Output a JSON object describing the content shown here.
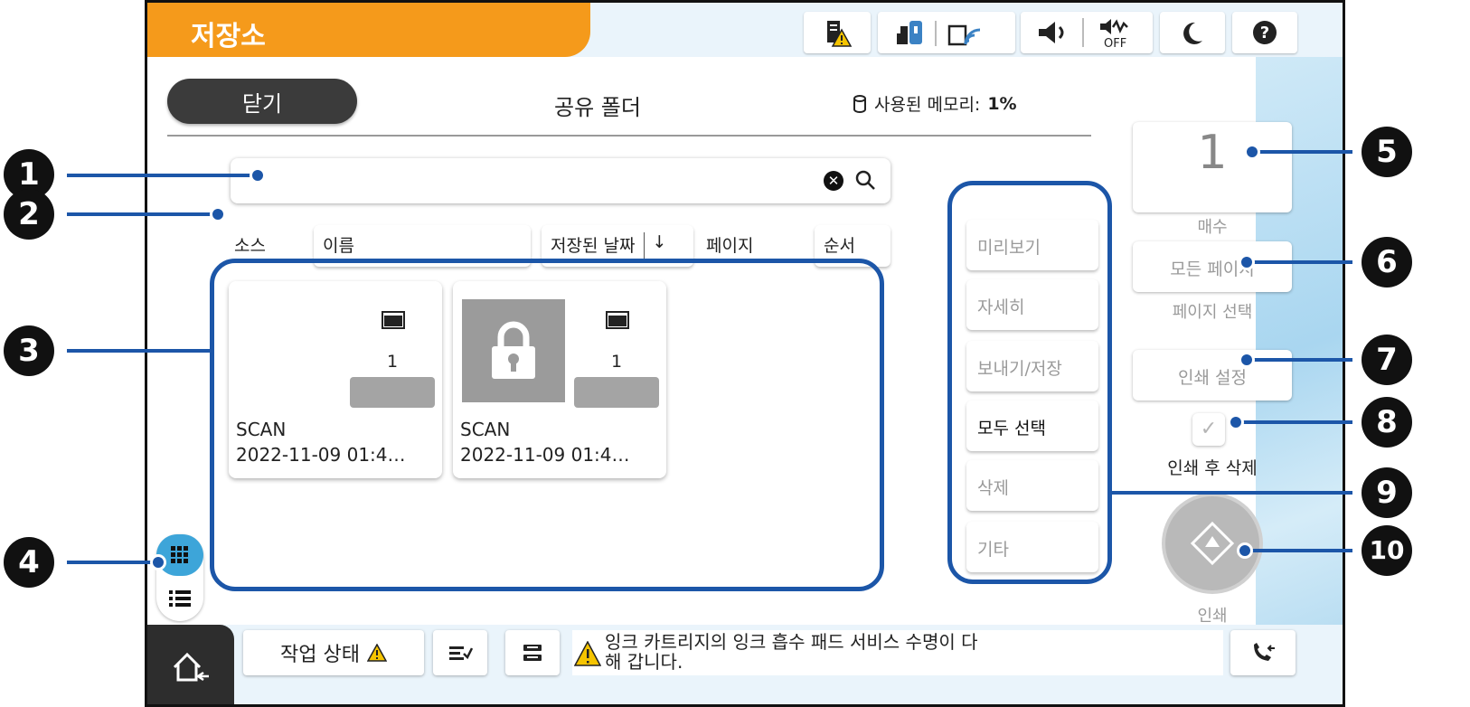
{
  "header": {
    "title": "저장소"
  },
  "main": {
    "close_label": "닫기",
    "page_title": "공유 폴더",
    "memory_label": "사용된 메모리:",
    "memory_value": "1%"
  },
  "sort_headers": {
    "source": "소스",
    "name": "이름",
    "date": "저장된 날짜",
    "date_sort_icon": "↓",
    "pages": "페이지",
    "order": "순서"
  },
  "files": [
    {
      "name": "SCAN",
      "date": "2022-11-09 01:4…",
      "pages": "1",
      "locked": false
    },
    {
      "name": "SCAN",
      "date": "2022-11-09 01:4…",
      "pages": "1",
      "locked": true
    }
  ],
  "menu": {
    "preview": "미리보기",
    "details": "자세히",
    "send_save": "보내기/저장",
    "select_all": "모두 선택",
    "delete": "삭제",
    "other": "기타"
  },
  "right_panel": {
    "copies_value": "1",
    "copies_label": "매수",
    "pages_value": "모든 페이지",
    "pages_label": "페이지 선택",
    "print_settings": "인쇄 설정",
    "delete_after_print": "인쇄 후 삭제",
    "delete_after_print_checked": false,
    "print_label": "인쇄"
  },
  "bottom": {
    "job_status": "작업 상태",
    "status_line1": "잉크 카트리지의 잉크 흡수 패드 서비스 수명이 다",
    "status_line2": "해 갑니다."
  },
  "callouts": [
    "1",
    "2",
    "3",
    "4",
    "5",
    "6",
    "7",
    "8",
    "9",
    "10"
  ],
  "icons": {
    "top": [
      "printer-warning-icon",
      "ink-icon",
      "wifi-icon",
      "volume-icon",
      "quiet-off-icon",
      "sleep-icon",
      "help-icon"
    ],
    "bottom": [
      "home-icon",
      "warning-icon",
      "job-transfer-icon",
      "storage-icon",
      "fax-icon"
    ]
  },
  "colors": {
    "accent_orange": "#f59a1b",
    "callout_blue": "#1c56a8",
    "active_blue": "#3da5d9"
  }
}
